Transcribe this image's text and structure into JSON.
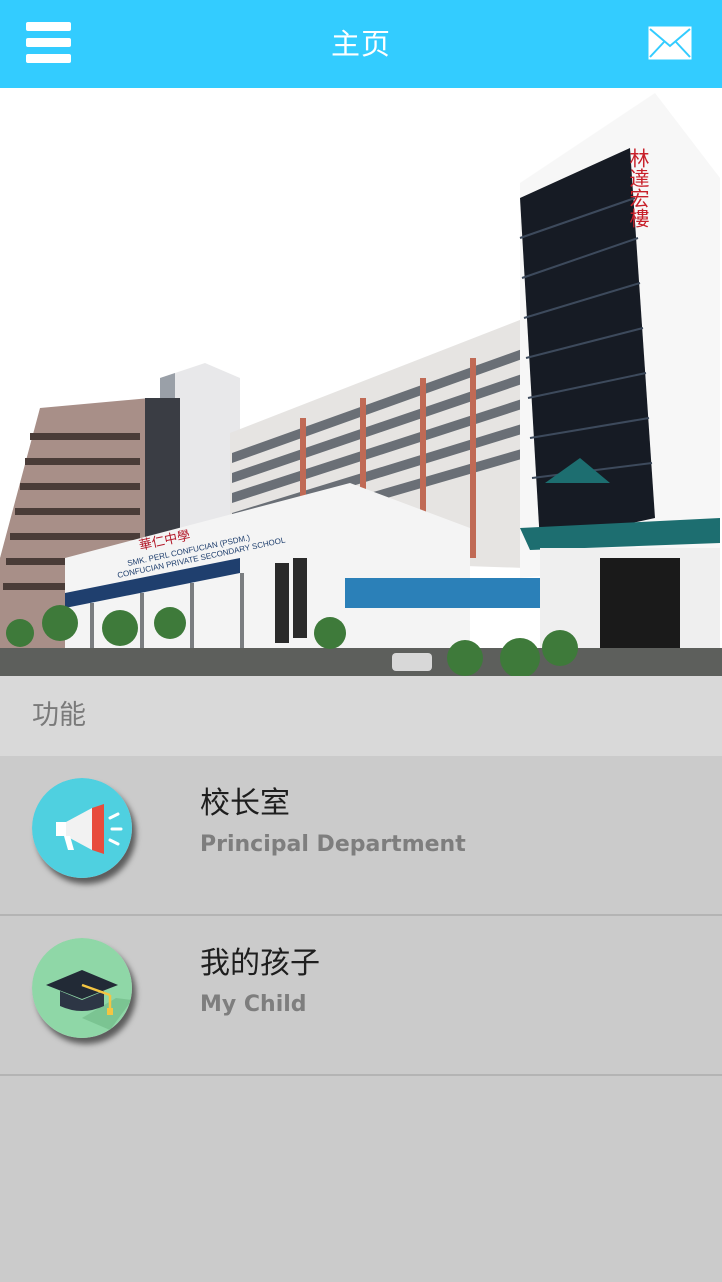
{
  "header": {
    "title": "主页"
  },
  "icons": {
    "menu": "menu-icon",
    "mail": "mail-icon",
    "principal": "megaphone-icon",
    "child": "graduation-cap-icon"
  },
  "banner": {
    "school_sign_cn": "華仁中學",
    "school_sign_en_1": "SMK. PERL CONFUCIAN (PSDM.)",
    "school_sign_en_2": "CONFUCIAN PRIVATE SECONDARY SCHOOL",
    "tower_sign": "林達宏樓"
  },
  "section": {
    "title": "功能"
  },
  "items": [
    {
      "title": "校长室",
      "subtitle": "Principal Department"
    },
    {
      "title": "我的孩子",
      "subtitle": "My Child"
    }
  ],
  "colors": {
    "appbar": "#33ccff",
    "icon_principal_bg": "#4fd0e0",
    "icon_child_bg": "#8fd7a7"
  }
}
